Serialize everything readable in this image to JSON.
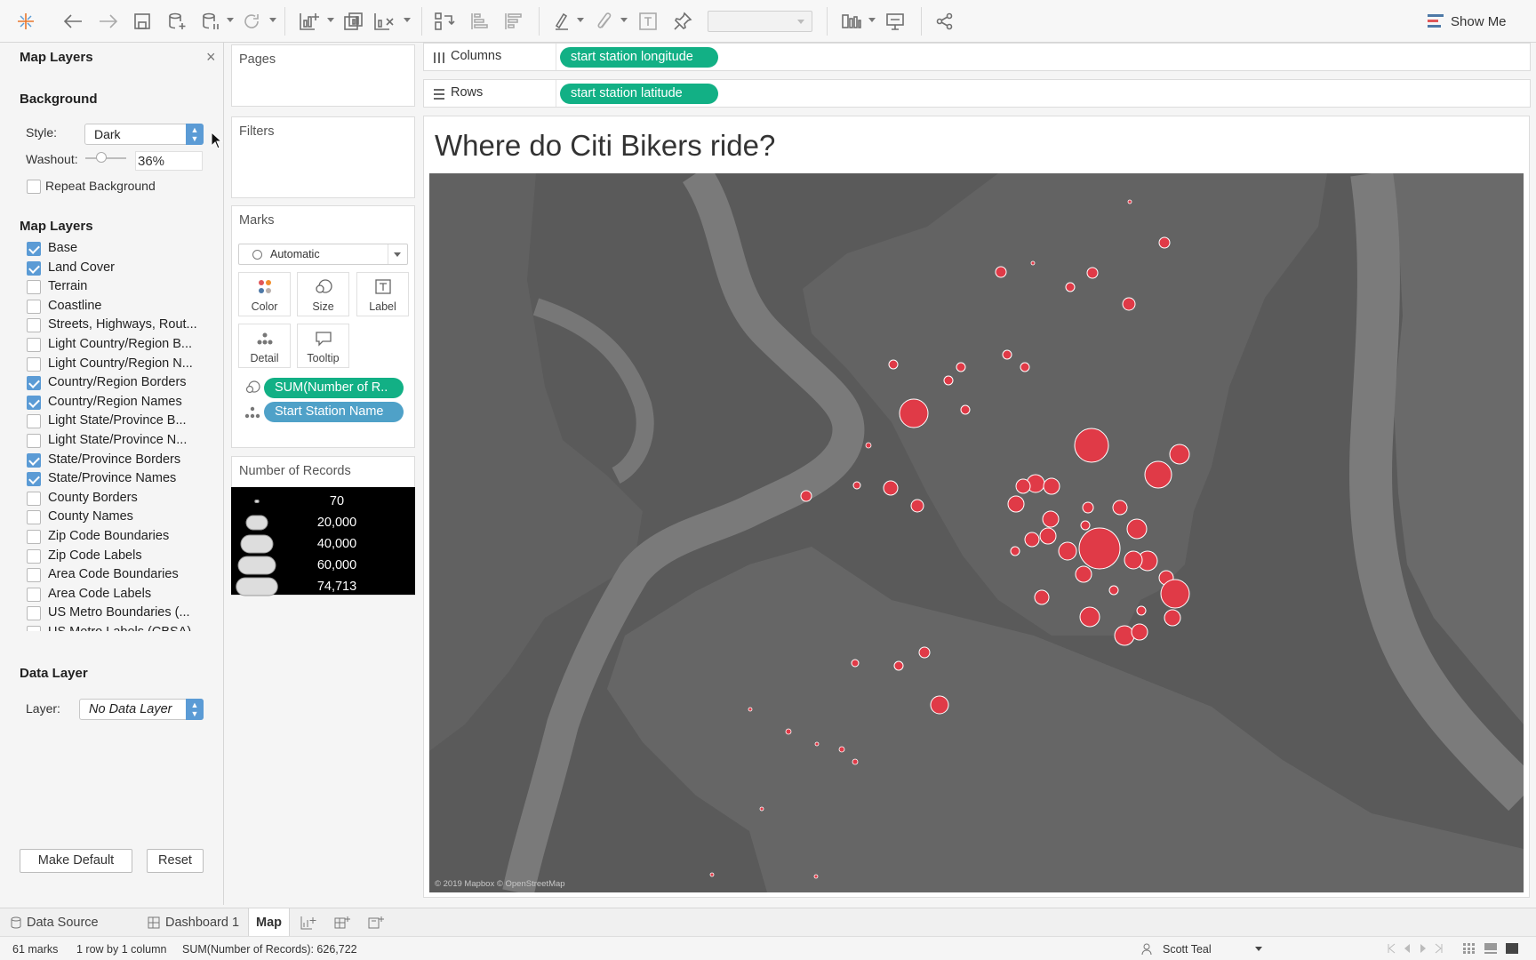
{
  "toolbar": {
    "show_me_label": "Show Me"
  },
  "left_panel": {
    "title": "Map Layers",
    "background": {
      "title": "Background",
      "style_label": "Style:",
      "style_value": "Dark",
      "washout_label": "Washout:",
      "washout_value": "36%",
      "washout_fraction": 0.36,
      "repeat_background_label": "Repeat Background",
      "repeat_background_checked": false
    },
    "map_layers": {
      "title": "Map Layers",
      "items": [
        {
          "label": "Base",
          "checked": true
        },
        {
          "label": "Land Cover",
          "checked": true
        },
        {
          "label": "Terrain",
          "checked": false
        },
        {
          "label": "Coastline",
          "checked": false
        },
        {
          "label": "Streets, Highways, Rout...",
          "checked": false
        },
        {
          "label": "Light Country/Region B...",
          "checked": false
        },
        {
          "label": "Light Country/Region N...",
          "checked": false
        },
        {
          "label": "Country/Region Borders",
          "checked": true
        },
        {
          "label": "Country/Region Names",
          "checked": true
        },
        {
          "label": "Light State/Province B...",
          "checked": false
        },
        {
          "label": "Light State/Province N...",
          "checked": false
        },
        {
          "label": "State/Province Borders",
          "checked": true
        },
        {
          "label": "State/Province Names",
          "checked": true
        },
        {
          "label": "County Borders",
          "checked": false
        },
        {
          "label": "County Names",
          "checked": false
        },
        {
          "label": "Zip Code Boundaries",
          "checked": false
        },
        {
          "label": "Zip Code Labels",
          "checked": false
        },
        {
          "label": "Area Code Boundaries",
          "checked": false
        },
        {
          "label": "Area Code Labels",
          "checked": false
        },
        {
          "label": "US Metro Boundaries (...",
          "checked": false
        },
        {
          "label": "US Metro Labels (CBSA)",
          "checked": false
        }
      ]
    },
    "data_layer": {
      "title": "Data Layer",
      "layer_label": "Layer:",
      "layer_value": "No Data Layer"
    },
    "make_default_label": "Make Default",
    "reset_label": "Reset"
  },
  "shelves": {
    "pages_title": "Pages",
    "filters_title": "Filters",
    "columns_label": "Columns",
    "columns_pill": "start station longitude",
    "rows_label": "Rows",
    "rows_pill": "start station latitude"
  },
  "marks": {
    "title": "Marks",
    "mark_type": "Automatic",
    "buttons": {
      "color": "Color",
      "size": "Size",
      "label": "Label",
      "detail": "Detail",
      "tooltip": "Tooltip"
    },
    "pill_size": "SUM(Number of R..",
    "pill_detail": "Start Station Name"
  },
  "legend": {
    "title": "Number of Records",
    "entries": [
      {
        "value": "70"
      },
      {
        "value": "20,000"
      },
      {
        "value": "40,000"
      },
      {
        "value": "60,000"
      },
      {
        "value": "74,713"
      }
    ]
  },
  "view": {
    "title": "Where do Citi Bikers ride?",
    "attribution": "© 2019 Mapbox © OpenStreetMap",
    "mark_color": "#e03a47",
    "map_background": "#5a5a5a"
  },
  "tabs": {
    "data_source": "Data Source",
    "dashboard": "Dashboard 1",
    "map": "Map"
  },
  "status": {
    "marks": "61 marks",
    "rows_cols": "1 row by 1 column",
    "sum": "SUM(Number of Records): 626,722",
    "user": "Scott Teal"
  }
}
